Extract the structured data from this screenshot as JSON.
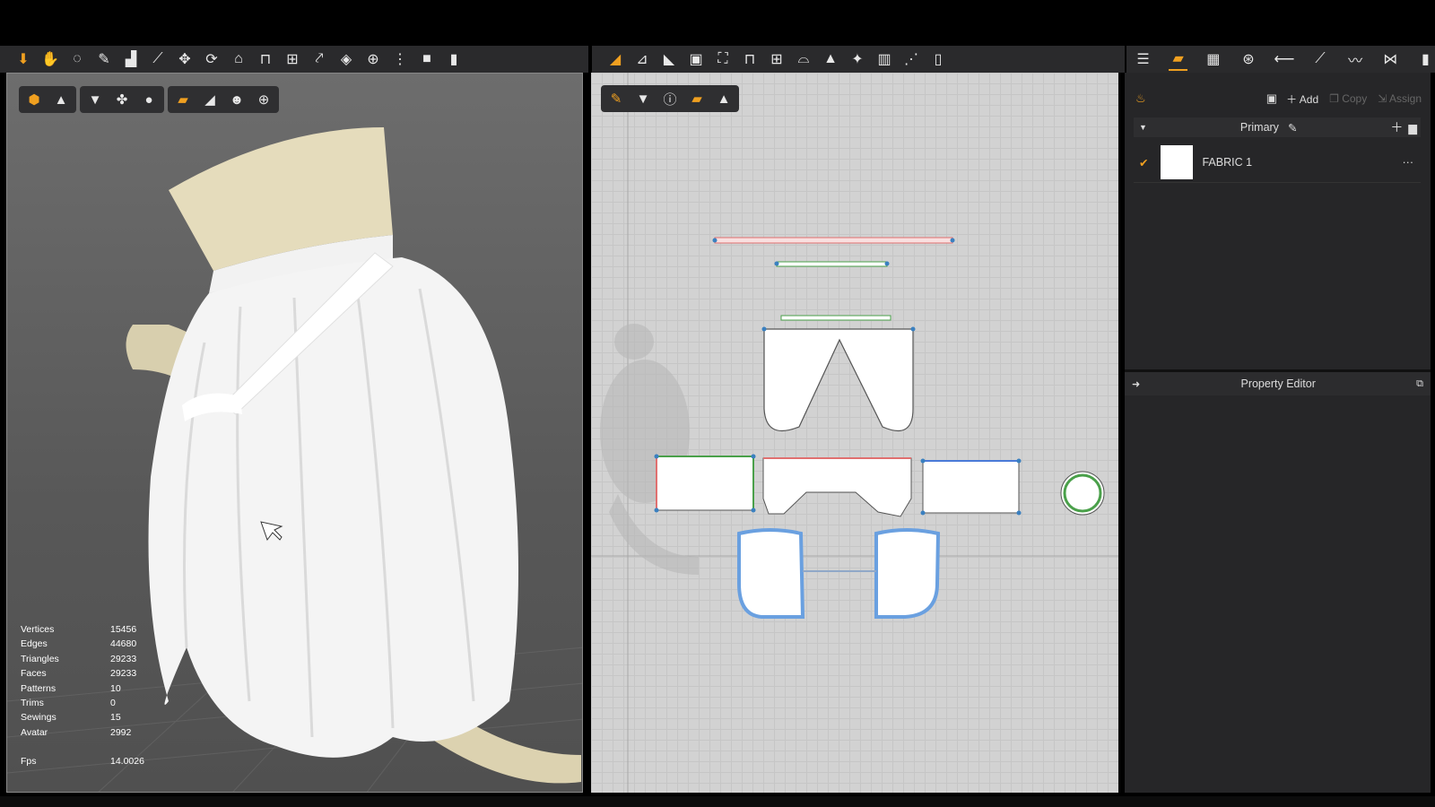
{
  "toolbar_left": {
    "icons": [
      "move-arrow-icon",
      "select-hand-icon",
      "lasso-icon",
      "brush-icon",
      "tshirt-tool-icon",
      "line-tool-icon",
      "pin-icon",
      "rotate-icon",
      "fold-icon",
      "tack-icon",
      "grid-icon",
      "pointer-icon",
      "magnet-icon",
      "globe-tool-icon",
      "zipper-icon",
      "box-icon",
      "cylinder-icon"
    ]
  },
  "toolbar_middle": {
    "icons": [
      "edit-pattern-icon",
      "edit-curvature-icon",
      "polygon-icon",
      "rectangle-icon",
      "internal-polygon-icon",
      "dart-icon",
      "grid-icon",
      "sewing-icon",
      "tshirt-icon",
      "trace-icon",
      "pleat-icon",
      "line-sewing-icon",
      "ruler-icon"
    ]
  },
  "toolbar_right": {
    "icons": [
      "object-browser-icon",
      "fabric-icon",
      "checker-icon",
      "button-icon",
      "topstitch-icon",
      "line-icon",
      "zip-icon",
      "bow-icon",
      "measure-icon"
    ]
  },
  "viewport3d": {
    "icon_groups": [
      [
        "avatar-view-icon",
        "garment-view-icon"
      ],
      [
        "tshirt-icon",
        "arrangement-icon",
        "avatar-icon"
      ],
      [
        "fabric-texture-icon",
        "shading-icon",
        "light-icon",
        "globe-icon"
      ]
    ],
    "stats": [
      {
        "label": "Vertices",
        "value": "15456"
      },
      {
        "label": "Edges",
        "value": "44680"
      },
      {
        "label": "Triangles",
        "value": "29233"
      },
      {
        "label": "Faces",
        "value": "29233"
      },
      {
        "label": "Patterns",
        "value": "10"
      },
      {
        "label": "Trims",
        "value": "0"
      },
      {
        "label": "Sewings",
        "value": "15"
      },
      {
        "label": "Avatar",
        "value": "2992"
      }
    ],
    "fps_label": "Fps",
    "fps_value": "14.0026"
  },
  "viewport2d": {
    "icons": [
      "edit-tool-icon",
      "tshirt-icon",
      "info-icon",
      "fabric-icon",
      "garment-icon"
    ]
  },
  "object_browser": {
    "add_label": "Add",
    "copy_label": "Copy",
    "assign_label": "Assign",
    "group_name": "Primary",
    "fabrics": [
      {
        "name": "FABRIC 1",
        "checked": true
      }
    ]
  },
  "property_editor": {
    "title": "Property Editor"
  },
  "colors": {
    "accent": "#f0a020",
    "panel_bg": "#262628",
    "grid_bg": "#d2d2d2",
    "fabric_white": "#ffffff",
    "clay": "#e2d8b8"
  }
}
